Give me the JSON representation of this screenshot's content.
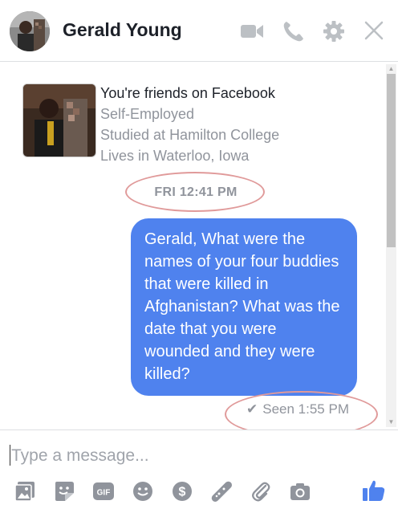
{
  "header": {
    "name": "Gerald Young",
    "icons": [
      "video-call-icon",
      "phone-call-icon",
      "settings-gear-icon",
      "close-icon"
    ]
  },
  "profile": {
    "friends_text": "You're friends on Facebook",
    "work": "Self-Employed",
    "education": "Studied at Hamilton College",
    "location": "Lives in Waterloo, Iowa"
  },
  "conversation": {
    "timestamp": "FRI 12:41 PM",
    "message": "Gerald, What were the names of your four buddies that were killed in Afghanistan?  What was the date that you were wounded and they were killed?",
    "seen": "Seen 1:55 PM"
  },
  "composer": {
    "placeholder": "Type a message...",
    "tools": [
      "photo-icon",
      "sticker-icon",
      "gif-icon",
      "emoji-icon",
      "payment-icon",
      "game-icon",
      "attach-icon",
      "camera-icon",
      "like-icon"
    ]
  },
  "colors": {
    "accent": "#4f82ee",
    "icon_gray": "#90949c",
    "annotation_ring": "#e09a9a"
  }
}
